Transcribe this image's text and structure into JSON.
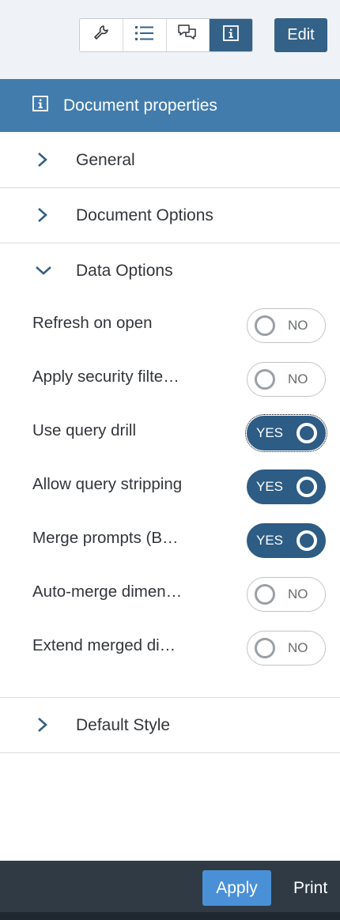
{
  "toolbar": {
    "buttons": [
      {
        "icon": "wrench-icon",
        "active": false
      },
      {
        "icon": "list-icon",
        "active": false
      },
      {
        "icon": "comments-icon",
        "active": false
      },
      {
        "icon": "info-icon",
        "active": true
      }
    ],
    "edit_label": "Edit"
  },
  "panel": {
    "title": "Document properties",
    "sections": [
      {
        "label": "General",
        "expanded": false
      },
      {
        "label": "Document Options",
        "expanded": false
      },
      {
        "label": "Data Options",
        "expanded": true
      },
      {
        "label": "Default Style",
        "expanded": false
      }
    ],
    "data_options": [
      {
        "label": "Refresh on open",
        "value": "NO"
      },
      {
        "label": "Apply security filte…",
        "value": "NO"
      },
      {
        "label": "Use query drill",
        "value": "YES",
        "focused": true
      },
      {
        "label": "Allow query stripping",
        "value": "YES"
      },
      {
        "label": "Merge prompts (B…",
        "value": "YES"
      },
      {
        "label": "Auto-merge dimen…",
        "value": "NO"
      },
      {
        "label": "Extend merged di…",
        "value": "NO"
      }
    ]
  },
  "footer": {
    "apply_label": "Apply",
    "print_label": "Print"
  },
  "colors": {
    "accent": "#346187",
    "header": "#427cac",
    "toggle_on": "#2d5c85",
    "footer": "#2f3a45",
    "apply": "#4a90d6"
  }
}
